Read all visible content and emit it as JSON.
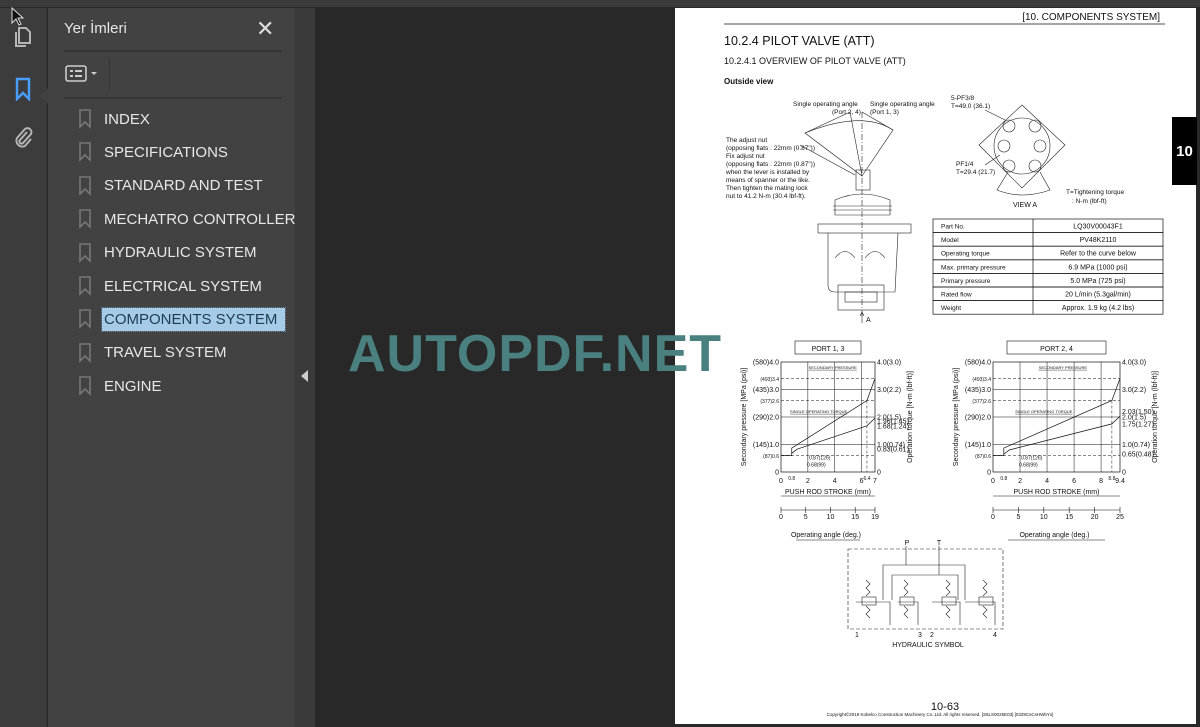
{
  "app": {
    "panel_title": "Yer İmleri"
  },
  "rail": {
    "icons": [
      "pages-icon",
      "bookmark-icon",
      "attachment-icon"
    ]
  },
  "bookmarks": [
    {
      "label": "INDEX"
    },
    {
      "label": "SPECIFICATIONS"
    },
    {
      "label": "STANDARD AND TEST"
    },
    {
      "label": "MECHATRO CONTROLLER"
    },
    {
      "label": "HYDRAULIC SYSTEM"
    },
    {
      "label": "ELECTRICAL SYSTEM"
    },
    {
      "label": "COMPONENTS SYSTEM",
      "selected": true
    },
    {
      "label": "TRAVEL SYSTEM"
    },
    {
      "label": "ENGINE"
    }
  ],
  "watermark": "AUTOPDF.NET",
  "colors": {
    "accent": "#4a9eff",
    "selection": "#a6cbe6",
    "watermark": "#4a8080"
  },
  "document": {
    "header": "[10.   COMPONENTS SYSTEM]",
    "chapter_tab": "10",
    "title": "10.2.4     PILOT VALVE (ATT)",
    "subtitle": "10.2.4.1     OVERVIEW OF PILOT VALVE (ATT)",
    "section": "Outside view",
    "callouts": {
      "angle_24": "Single operating angle",
      "angle_24_port": "(Port 2, 4)",
      "angle_13": "Single operating angle",
      "angle_13_port": "(Port 1, 3)",
      "adjust_note": [
        "The adjust nut",
        "(opposing flats : 22mm (0.87\"))",
        "Fix adjust nut",
        "(opposing flats : 22mm (0.87\"))",
        "when the lever is installed by",
        "means of spanner or the like.",
        "Then tighten the mating lock",
        "nut to 41.2 N-m (30.4 lbf-ft)."
      ],
      "port_pf38": "5-PF3/8",
      "torque_pf38": "T=49.0 (36.1)",
      "port_pf14": "PF1/4",
      "torque_pf14": "T=29.4 (21.7)",
      "view_a": "VIEW  A",
      "arrow_a": "A",
      "torque_legend_1": "T=Tightening torque",
      "torque_legend_2": ": N-m (lbf-ft)"
    },
    "specs": [
      {
        "label": "Part No.",
        "value": "LQ30V00043F1"
      },
      {
        "label": "Model",
        "value": "PV48K2110"
      },
      {
        "label": "Operating torque",
        "value": "Refer to the curve below"
      },
      {
        "label": "Max. primary pressure",
        "value": "6.9 MPa (1000 psi)"
      },
      {
        "label": "Primary pressure",
        "value": "5.0 MPa (725 psi)"
      },
      {
        "label": "Rated flow",
        "value": "20 L/min (5.3gal/min)"
      },
      {
        "label": "Weight",
        "value": "Approx. 1.9 kg (4.2 lbs)"
      }
    ],
    "hydraulic": {
      "p": "P",
      "t": "T",
      "ports": [
        "1",
        "3",
        "2",
        "4"
      ],
      "caption": "HYDRAULIC SYMBOL"
    },
    "page_number": "10-63",
    "copyright": "Copyright©2019 Kobelco Construction Machinery Co.,Ltd. All rights reserved. [S5LS0025E03] [0329CsCsHWbYs]"
  },
  "chart_data": [
    {
      "type": "line",
      "title": "PORT 1, 3",
      "xlabel": "PUSH ROD STROKE (mm)",
      "ylabel": "Secondary pressure [MPa (psi)]",
      "y2label": "Operation torque [N-m (lbf-ft)]",
      "angle_label": "Operating angle (deg.)",
      "xlim": [
        0,
        7
      ],
      "ylim": [
        0,
        4.0
      ],
      "xticks": [
        "0",
        "0.8",
        "2",
        "4",
        "6",
        "6.4",
        "7"
      ],
      "xtick_values": [
        0,
        0.8,
        2,
        4,
        6,
        6.4,
        7
      ],
      "yticks_left": [
        "(580)4.0",
        "(493)3.4",
        "(435)3.0",
        "(377)2.6",
        "(290)2.0",
        "(145)1.0",
        "(87)0.6",
        "0"
      ],
      "yticks_left_values": [
        4.0,
        3.4,
        3.0,
        2.6,
        2.0,
        1.0,
        0.6,
        0
      ],
      "yticks_right": [
        "4.0(3.0)",
        "3.0(2.2)",
        "2.0(1.5)",
        "1.96(1.45)",
        "1.68(1.24)",
        "1.0(0.74)",
        "0.83(0.61)",
        "0"
      ],
      "yticks_right_values": [
        4.0,
        3.0,
        2.0,
        1.85,
        1.68,
        1.0,
        0.83,
        0
      ],
      "angle_ticks": [
        "0",
        "5",
        "10",
        "15",
        "19"
      ],
      "angle_max": 19,
      "annotations": [
        "SECONDARY PRESSURE",
        "SINGLE OPERATING TORQUE",
        "0.87(126)",
        "0.68(99)"
      ],
      "series": [
        {
          "name": "SECONDARY PRESSURE",
          "points": [
            [
              0,
              0.6
            ],
            [
              0.8,
              0.6
            ],
            [
              0.8,
              0.87
            ],
            [
              6.4,
              2.6
            ],
            [
              7,
              3.4
            ]
          ]
        },
        {
          "name": "SINGLE OPERATING TORQUE",
          "points": [
            [
              0.8,
              0.68
            ],
            [
              1.2,
              0.83
            ],
            [
              6.4,
              1.68
            ],
            [
              7,
              1.96
            ]
          ]
        }
      ],
      "grid": true
    },
    {
      "type": "line",
      "title": "PORT 2, 4",
      "xlabel": "PUSH ROD STROKE (mm)",
      "ylabel": "Secondary pressure [MPa (psi)]",
      "y2label": "Operation torque [N-m (lbf-ft)]",
      "angle_label": "Operating angle (deg.)",
      "xlim": [
        0,
        9.4
      ],
      "ylim": [
        0,
        4.0
      ],
      "xticks": [
        "0",
        "0.8",
        "2",
        "4",
        "6",
        "8",
        "8.8",
        "9.4"
      ],
      "xtick_values": [
        0,
        0.8,
        2,
        4,
        6,
        8,
        8.8,
        9.4
      ],
      "yticks_left": [
        "(580)4.0",
        "(493)3.4",
        "(435)3.0",
        "(377)2.6",
        "(290)2.0",
        "(145)1.0",
        "(87)0.6",
        "0"
      ],
      "yticks_left_values": [
        4.0,
        3.4,
        3.0,
        2.6,
        2.0,
        1.0,
        0.6,
        0
      ],
      "yticks_right": [
        "4.0(3.0)",
        "3.0(2.2)",
        "2.03(1.50)",
        "2.0(1.5)",
        "1.75(1.27)",
        "1.0(0.74)",
        "0.65(0.48)",
        "0"
      ],
      "yticks_right_values": [
        4.0,
        3.0,
        2.2,
        2.0,
        1.75,
        1.0,
        0.65,
        0
      ],
      "angle_ticks": [
        "0",
        "5",
        "10",
        "15",
        "20",
        "25"
      ],
      "angle_max": 25,
      "annotations": [
        "SECONDARY PRESSURE",
        "SINGLE OPERATING TORQUE",
        "0.87(126)",
        "0.68(99)"
      ],
      "series": [
        {
          "name": "SECONDARY PRESSURE",
          "points": [
            [
              0,
              0.6
            ],
            [
              0.8,
              0.6
            ],
            [
              0.8,
              0.87
            ],
            [
              8.8,
              2.6
            ],
            [
              9.4,
              3.4
            ]
          ]
        },
        {
          "name": "SINGLE OPERATING TORQUE",
          "points": [
            [
              0.8,
              0.65
            ],
            [
              1.2,
              0.8
            ],
            [
              8.8,
              1.75
            ],
            [
              9.4,
              2.03
            ]
          ]
        }
      ],
      "grid": true
    }
  ]
}
